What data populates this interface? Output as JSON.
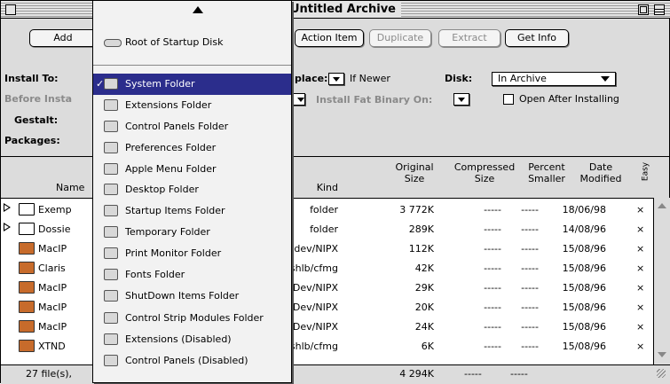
{
  "window": {
    "title": "Untitled Archive"
  },
  "toolbar": {
    "add": "Add",
    "action_item": "Action Item",
    "duplicate": "Duplicate",
    "extract": "Extract",
    "get_info": "Get Info"
  },
  "settings": {
    "install_to_label": "Install To:",
    "before_install_label": "Before Insta",
    "gestalt_label": "Gestalt:",
    "packages_label": "Packages:",
    "replace_label": "place:",
    "replace_value": "If Newer",
    "disk_label": "Disk:",
    "disk_value": "In Archive",
    "install_fat_label": "Install Fat Binary On:",
    "open_after_label": "Open After Installing"
  },
  "table": {
    "headers": {
      "name": "Name",
      "kind": "Kind",
      "original_size_1": "Original",
      "original_size_2": "Size",
      "compressed_size_1": "Compressed",
      "compressed_size_2": "Size",
      "percent_smaller_1": "Percent",
      "percent_smaller_2": "Smaller",
      "date_modified_1": "Date",
      "date_modified_2": "Modified",
      "easy": "Easy"
    },
    "rows": [
      {
        "name": "Exemp",
        "kind": "folder",
        "original": "3 772K",
        "compressed": "-----",
        "percent": "-----",
        "date": "18/06/98",
        "easy": "×",
        "icon": "folder-icon"
      },
      {
        "name": "Dossie",
        "kind": "folder",
        "original": "289K",
        "compressed": "-----",
        "percent": "-----",
        "date": "14/08/96",
        "easy": "×",
        "icon": "folder-icon"
      },
      {
        "name": "MacIP",
        "kind": "cdev/NIPX",
        "original": "112K",
        "compressed": "-----",
        "percent": "-----",
        "date": "15/08/96",
        "easy": "×",
        "icon": "control-panel-icon"
      },
      {
        "name": "Claris",
        "kind": "shlb/cfmg",
        "original": "42K",
        "compressed": "-----",
        "percent": "-----",
        "date": "15/08/96",
        "easy": "×",
        "icon": "library-icon"
      },
      {
        "name": "MacIP",
        "kind": "nDev/NIPX",
        "original": "29K",
        "compressed": "-----",
        "percent": "-----",
        "date": "15/08/96",
        "easy": "×",
        "icon": "network-driver-icon"
      },
      {
        "name": "MacIP",
        "kind": "nDev/NIPX",
        "original": "20K",
        "compressed": "-----",
        "percent": "-----",
        "date": "15/08/96",
        "easy": "×",
        "icon": "network-driver-icon"
      },
      {
        "name": "MacIP",
        "kind": "nDev/NIPX",
        "original": "24K",
        "compressed": "-----",
        "percent": "-----",
        "date": "15/08/96",
        "easy": "×",
        "icon": "network-driver-icon"
      },
      {
        "name": "XTND",
        "kind": "shlb/cfmg",
        "original": "6K",
        "compressed": "-----",
        "percent": "-----",
        "date": "15/08/96",
        "easy": "×",
        "icon": "library-icon"
      }
    ]
  },
  "footer": {
    "file_count": "27 file(s),",
    "total_original": "4 294K",
    "total_compressed": "-----",
    "total_percent": "-----"
  },
  "menu": {
    "items": [
      {
        "label": "Root of Startup Disk",
        "icon": "disk-icon",
        "selected": false
      },
      {
        "label": "System Folder",
        "icon": "system-folder-icon",
        "selected": true
      },
      {
        "label": "Extensions Folder",
        "icon": "extensions-folder-icon",
        "selected": false
      },
      {
        "label": "Control Panels Folder",
        "icon": "control-panels-folder-icon",
        "selected": false
      },
      {
        "label": "Preferences Folder",
        "icon": "preferences-folder-icon",
        "selected": false
      },
      {
        "label": "Apple Menu Folder",
        "icon": "apple-menu-folder-icon",
        "selected": false
      },
      {
        "label": "Desktop Folder",
        "icon": "desktop-folder-icon",
        "selected": false
      },
      {
        "label": "Startup Items Folder",
        "icon": "startup-items-folder-icon",
        "selected": false
      },
      {
        "label": "Temporary Folder",
        "icon": "temporary-folder-icon",
        "selected": false
      },
      {
        "label": "Print Monitor Folder",
        "icon": "print-monitor-folder-icon",
        "selected": false
      },
      {
        "label": "Fonts Folder",
        "icon": "fonts-folder-icon",
        "selected": false
      },
      {
        "label": "ShutDown Items Folder",
        "icon": "shutdown-items-folder-icon",
        "selected": false
      },
      {
        "label": "Control Strip Modules Folder",
        "icon": "control-strip-folder-icon",
        "selected": false
      },
      {
        "label": "Extensions (Disabled)",
        "icon": "extensions-disabled-folder-icon",
        "selected": false
      },
      {
        "label": "Control Panels (Disabled)",
        "icon": "control-panels-disabled-folder-icon",
        "selected": false
      }
    ],
    "check_mark": "✓"
  },
  "colors": {
    "selection": "#2b2d8c",
    "window_bg": "#dcdcdc"
  }
}
